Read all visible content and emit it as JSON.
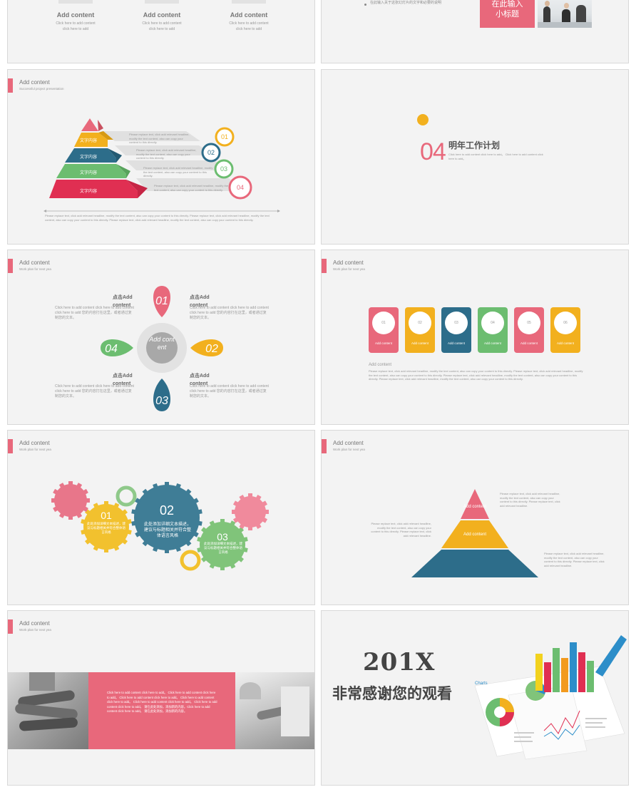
{
  "s1": {
    "items": [
      {
        "title": "Add content",
        "l1": "Click here to add content",
        "l2": "click here to add"
      },
      {
        "title": "Add content",
        "l1": "Click here to add content",
        "l2": "click here to add"
      },
      {
        "title": "Add content",
        "l1": "Click here to add content",
        "l2": "click here to add"
      }
    ]
  },
  "s2": {
    "bullet": "在此输入关于这张幻灯片的文字和必要的说明",
    "box_l1": "在此输入",
    "box_l2": "小标题"
  },
  "s3": {
    "title": "Add content",
    "subtitle": "Successful project presentation",
    "layer": "文字内容",
    "nums": [
      "01",
      "02",
      "03",
      "04"
    ],
    "note": "Please replace text, click add relevant headline, modify the text content, also can copy your content to this directly.",
    "footer": "Please replace text, click add relevant headline, modify the text content, also can copy your content to this directly. Please replace text, click add relevant headline, modify the text content, also can copy your content to this directly. Please replace text, click add relevant headline, modify the text content, also can copy your content to this directly."
  },
  "s4": {
    "num": "04",
    "title": "明年工作计划",
    "line": "Click here to add content click here to add。 Click here to add content click here to add。"
  },
  "s5": {
    "title": "Add content",
    "subtitle": "Work plan for next yea",
    "label": "点击Add content",
    "body": "Click here to add content click here to add content click here to add 您的内容打在这里，或者通过复制您的文本。",
    "nums": [
      "01",
      "02",
      "03",
      "04"
    ],
    "center": "Add content"
  },
  "s6": {
    "title": "Add content",
    "subtitle": "Work plan for next yea",
    "cards": [
      {
        "num": "01",
        "label": "Add content",
        "color": "#e8687b"
      },
      {
        "num": "02",
        "label": "Add content",
        "color": "#f2b01e"
      },
      {
        "num": "03",
        "label": "Add content",
        "color": "#2d6d8a"
      },
      {
        "num": "04",
        "label": "Add content",
        "color": "#6cbd70"
      },
      {
        "num": "05",
        "label": "Add content",
        "color": "#e8687b"
      },
      {
        "num": "06",
        "label": "Add content",
        "color": "#f2b01e"
      }
    ],
    "body_title": "Add content",
    "body": "Please replace text, click add relevant headline, modify the text content, also can copy your content to this directly. Please replace text, click add relevant headline, modify the text content, also can copy your content to this directly. Please replace text, click add relevant headline, modify the text content, also can copy your content to this directly. Please replace text, click add relevant headline, modify the text content, also can copy your content to this directly."
  },
  "s7": {
    "title": "Add content",
    "subtitle": "Work plan for next yea",
    "g1_num": "01",
    "g1_text": "此处添加详细文本描述，建议与标题相关并符合整体语言风格",
    "g2_num": "02",
    "g2_text": "此处添加详细文本描述，建议与标题相关并符合整体语言风格",
    "g3_num": "03",
    "g3_text": "此处添加详细文本描述，建议与标题相关并符合整体语言风格"
  },
  "s8": {
    "title": "Add content",
    "subtitle": "Work plan for next yea",
    "top": "Add content",
    "mid": "Add content",
    "note": "Please replace text, click add relevant headline, modify the text content, also can copy your content to this directly. Please replace text, click add relevant headline."
  },
  "s9": {
    "title": "Add content",
    "subtitle": "Work plan for next yea",
    "body": "Click here to add content click here to add。 Click here to add content click here to add。 Click here to add content click here to add。 Click here to add content click here to add。 Click here to add content click here to add。 Click here to add content click here to add。 请在此处添加，添加新的内容。Click here to add content click here to add。 请在此处添加，添加新的内容。"
  },
  "s10": {
    "year": "201X",
    "thanks": "非常感谢您的观看",
    "chart_label": "Charts"
  },
  "colors": {
    "pink": "#e8687b",
    "yellow": "#f2b01e",
    "teal": "#2d6d8a",
    "green": "#6cbd70",
    "bg": "#f3f3f3"
  }
}
